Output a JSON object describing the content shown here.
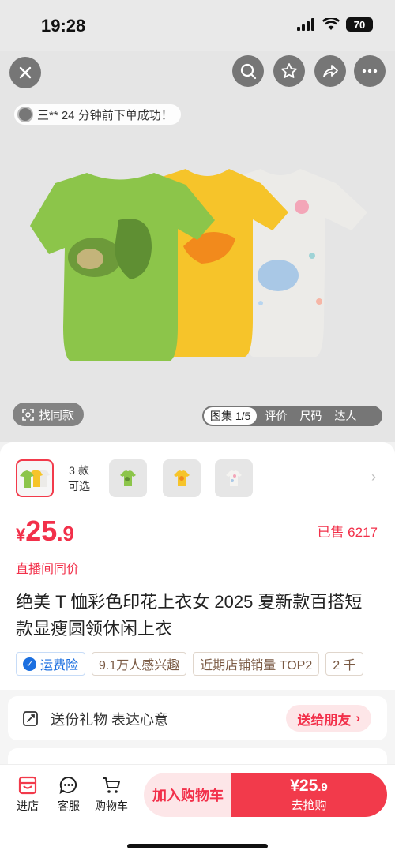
{
  "status_bar": {
    "time": "19:28",
    "battery": "70"
  },
  "hero": {
    "notice": "三** 24 分钟前下单成功！",
    "find_same": "找同款",
    "tabs": [
      "图集 1/5",
      "评价",
      "尺码",
      "达人"
    ]
  },
  "variants": {
    "count_line1": "3 款",
    "count_line2": "可选",
    "items": [
      "avocado-green",
      "mango-yellow",
      "shell-white"
    ]
  },
  "price": {
    "yen": "¥",
    "int": "25",
    "dec": ".9",
    "sold": "已售 6217"
  },
  "live_same_price": "直播间同价",
  "title": "绝美 T 恤彩色印花上衣女 2025 夏新款百搭短款显瘦圆领休闲上衣",
  "tags": {
    "shipping": "运费险",
    "items": [
      "9.1万人感兴趣",
      "近期店铺销量 TOP2",
      "2 千"
    ]
  },
  "gift": {
    "text": "送份礼物 表达心意",
    "button": "送给朋友"
  },
  "bottom_bar": {
    "shop": "进店",
    "service": "客服",
    "cart": "购物车",
    "add_cart": "加入购物车",
    "buy_price_int": "¥25",
    "buy_price_dec": ".9",
    "buy_label": "去抢购"
  },
  "colors": {
    "accent": "#f23a4b",
    "green_tee": "#8cc54a",
    "yellow_tee": "#f6c42a",
    "white_tee": "#ecebe8"
  }
}
